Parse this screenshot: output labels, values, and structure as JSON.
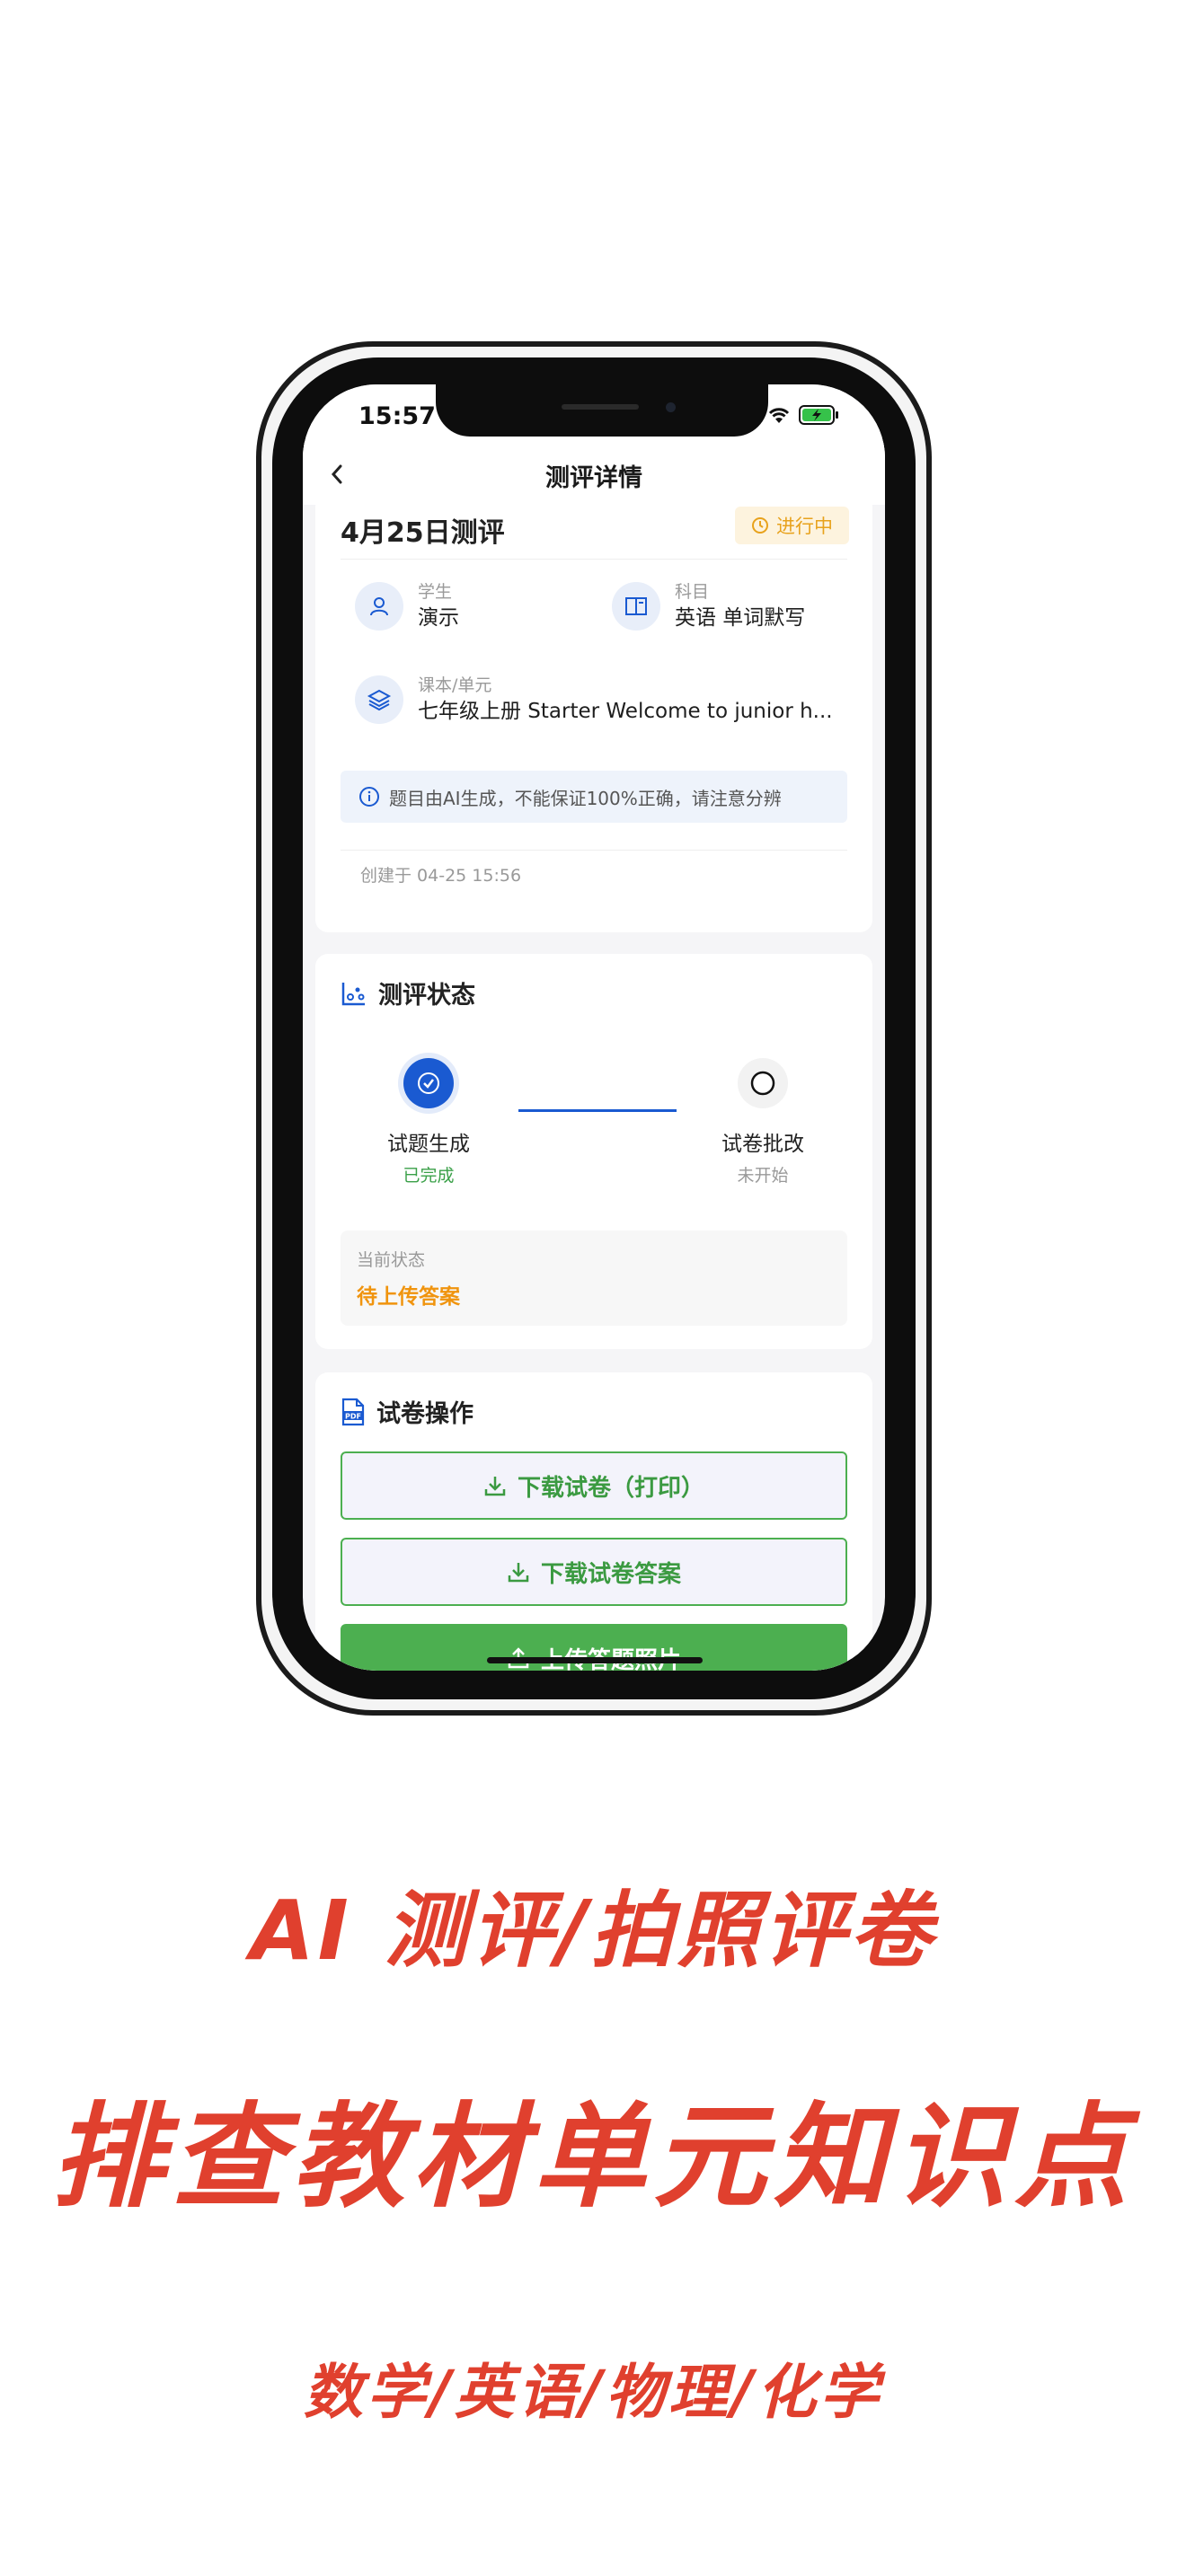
{
  "status_bar": {
    "time": "15:57"
  },
  "nav": {
    "title": "测评详情"
  },
  "overview": {
    "title": "4月25日测评",
    "badge": "进行中",
    "student_label": "学生",
    "student_value": "演示",
    "subject_label": "科目",
    "subject_value": "英语 单词默写",
    "unit_label": "课本/单元",
    "unit_value": "七年级上册 Starter Welcome to junior h...",
    "notice": "题目由AI生成，不能保证100%正确，请注意分辨",
    "created": "创建于 04-25 15:56"
  },
  "status": {
    "title": "测评状态",
    "steps": [
      {
        "name": "试题生成",
        "status": "已完成"
      },
      {
        "name": "试卷批改",
        "status": "未开始"
      }
    ],
    "current_label": "当前状态",
    "current_value": "待上传答案"
  },
  "actions": {
    "title": "试卷操作",
    "download_paper": "下载试卷（打印）",
    "download_answers": "下载试卷答案",
    "upload_photos": "上传答题照片"
  },
  "promo": {
    "line1": "AI 测评/拍照评卷",
    "line2": "排查教材单元知识点",
    "line3": "数学/英语/物理/化学"
  },
  "colors": {
    "accent_blue": "#1a5ad1",
    "green": "#4caf50",
    "orange": "#f0940e",
    "promo_red": "#e0402e"
  }
}
